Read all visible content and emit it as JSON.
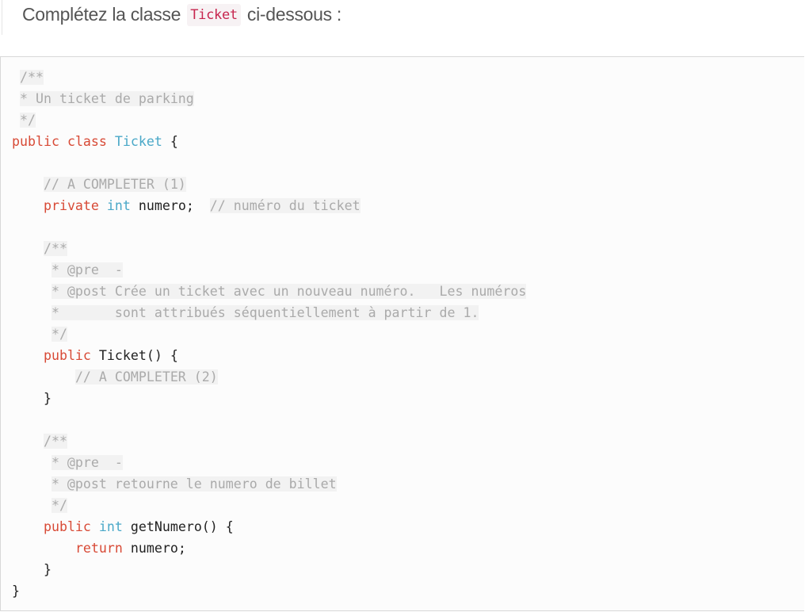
{
  "prompt": {
    "before": "Complétez la classe ",
    "class_name": "Ticket",
    "after": " ci-dessous :"
  },
  "colors": {
    "keyword": "#d84a36",
    "type": "#4aa8c8",
    "comment": "#aaaaaa",
    "text": "#222222",
    "inline_code": "#c7254e"
  },
  "code_lines": [
    [
      [
        " ",
        "tx"
      ],
      [
        "/**",
        "cm"
      ]
    ],
    [
      [
        " ",
        "tx"
      ],
      [
        "* Un ticket de parking",
        "cm"
      ]
    ],
    [
      [
        " ",
        "tx"
      ],
      [
        "*/",
        "cm"
      ]
    ],
    [
      [
        "public",
        "kw"
      ],
      [
        " ",
        "tx"
      ],
      [
        "class",
        "kw"
      ],
      [
        " ",
        "tx"
      ],
      [
        "Ticket",
        "ty"
      ],
      [
        " {",
        "tx"
      ]
    ],
    [],
    [
      [
        "    ",
        "tx"
      ],
      [
        "// A COMPLETER (1)",
        "cm"
      ]
    ],
    [
      [
        "    ",
        "tx"
      ],
      [
        "private",
        "kw"
      ],
      [
        " ",
        "tx"
      ],
      [
        "int",
        "ty"
      ],
      [
        " numero;  ",
        "tx"
      ],
      [
        "// numéro du ticket",
        "cm"
      ]
    ],
    [],
    [
      [
        "    ",
        "tx"
      ],
      [
        "/**",
        "cm"
      ]
    ],
    [
      [
        "     ",
        "tx"
      ],
      [
        "* @pre  -",
        "cm"
      ]
    ],
    [
      [
        "     ",
        "tx"
      ],
      [
        "* @post Crée un ticket avec un nouveau numéro.   Les numéros",
        "cm"
      ]
    ],
    [
      [
        "     ",
        "tx"
      ],
      [
        "*       sont attribués séquentiellement à partir de 1.",
        "cm"
      ]
    ],
    [
      [
        "     ",
        "tx"
      ],
      [
        "*/",
        "cm"
      ]
    ],
    [
      [
        "    ",
        "tx"
      ],
      [
        "public",
        "kw"
      ],
      [
        " Ticket() {",
        "tx"
      ]
    ],
    [
      [
        "        ",
        "tx"
      ],
      [
        "// A COMPLETER (2)",
        "cm"
      ]
    ],
    [
      [
        "    }",
        "tx"
      ]
    ],
    [],
    [
      [
        "    ",
        "tx"
      ],
      [
        "/**",
        "cm"
      ]
    ],
    [
      [
        "     ",
        "tx"
      ],
      [
        "* @pre  -",
        "cm"
      ]
    ],
    [
      [
        "     ",
        "tx"
      ],
      [
        "* @post retourne le numero de billet",
        "cm"
      ]
    ],
    [
      [
        "     ",
        "tx"
      ],
      [
        "*/",
        "cm"
      ]
    ],
    [
      [
        "    ",
        "tx"
      ],
      [
        "public",
        "kw"
      ],
      [
        " ",
        "tx"
      ],
      [
        "int",
        "ty"
      ],
      [
        " getNumero() {",
        "tx"
      ]
    ],
    [
      [
        "        ",
        "tx"
      ],
      [
        "return",
        "kw"
      ],
      [
        " numero;",
        "tx"
      ]
    ],
    [
      [
        "    }",
        "tx"
      ]
    ],
    [
      [
        "}",
        "tx"
      ]
    ]
  ]
}
